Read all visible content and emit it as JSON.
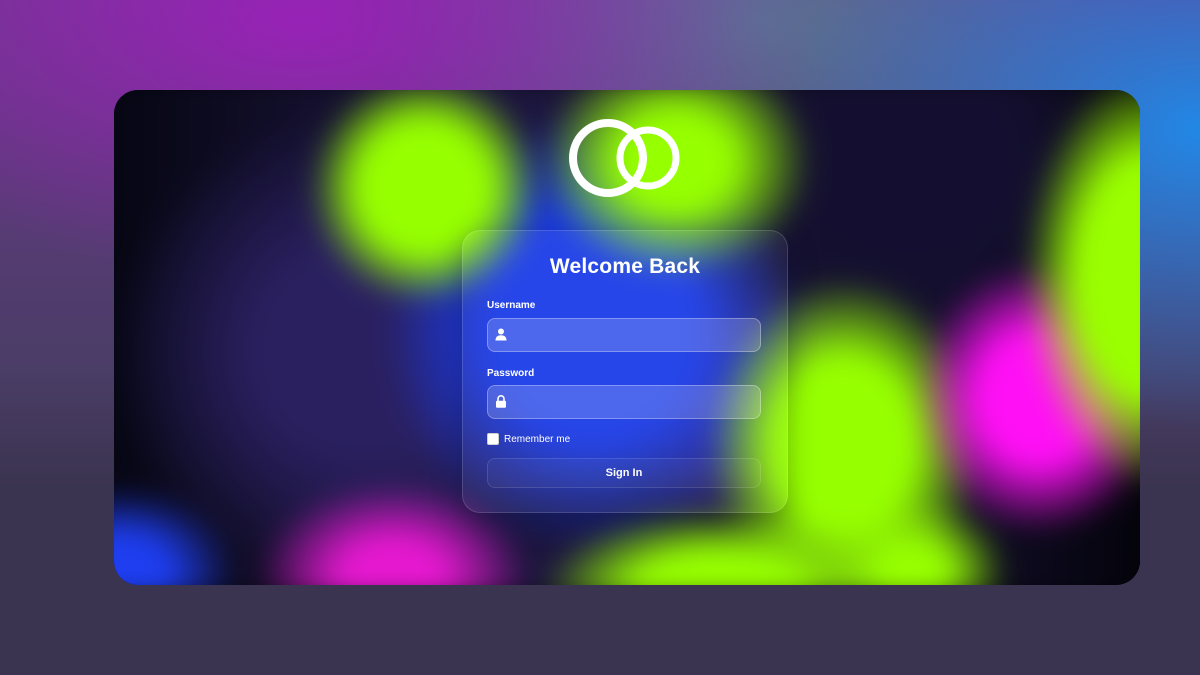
{
  "login": {
    "title": "Welcome Back",
    "username": {
      "label": "Username",
      "value": "",
      "placeholder": "",
      "icon": "user-icon"
    },
    "password": {
      "label": "Password",
      "value": "",
      "placeholder": "",
      "icon": "lock-icon"
    },
    "remember_me": {
      "label": "Remember me",
      "checked": false
    },
    "submit_label": "Sign In"
  },
  "logo": {
    "icon": "interlocking-rings-logo"
  },
  "colors": {
    "page_background": "#3b3450",
    "blob_green": "#96ff00",
    "blob_blue": "#1a3be8",
    "blob_magenta": "#ff10f5",
    "text": "#ffffff"
  }
}
